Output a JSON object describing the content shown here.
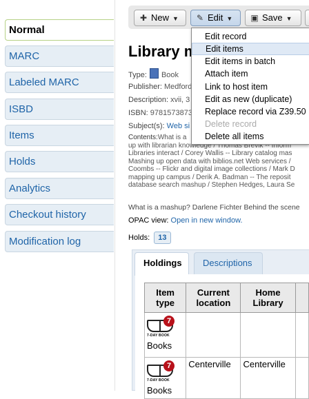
{
  "sidebar": {
    "items": [
      {
        "label": "Normal",
        "active": true
      },
      {
        "label": "MARC"
      },
      {
        "label": "Labeled MARC"
      },
      {
        "label": "ISBD"
      },
      {
        "label": "Items"
      },
      {
        "label": "Holds"
      },
      {
        "label": "Analytics"
      },
      {
        "label": "Checkout history"
      },
      {
        "label": "Modification log"
      }
    ]
  },
  "toolbar": {
    "new_label": "New",
    "edit_label": "Edit",
    "save_label": "Save"
  },
  "edit_menu": {
    "items": [
      {
        "label": "Edit record"
      },
      {
        "label": "Edit items",
        "highlighted": true
      },
      {
        "label": "Edit items in batch"
      },
      {
        "label": "Attach item"
      },
      {
        "label": "Link to host item"
      },
      {
        "label": "Edit as new (duplicate)"
      },
      {
        "label": "Replace record via Z39.50"
      },
      {
        "label": "Delete record",
        "disabled": true
      },
      {
        "label": "Delete all items"
      }
    ]
  },
  "record": {
    "title": "Library m",
    "type_label": "Type:",
    "type_value": "Book",
    "publisher_label": "Publisher:",
    "publisher_value": "Medford",
    "description_label": "Description:",
    "description_value": "xvii, 3",
    "isbn_label": "ISBN:",
    "isbn_value": "9781573873",
    "subjects_label": "Subject(s):",
    "subjects_value": "Web si",
    "contents_label": "Contents:",
    "contents_lines": [
      "What is a",
      "up with librarian knowledge / Thomas Brevik -- Inform",
      "Libraries interact / Corey Wallis -- Library catalog mas",
      "Mashing up open data with biblios.net Web services /",
      "Coombs -- Flickr and digital image collections / Mark D",
      "mapping up campus / Derik A. Badman -- The reposit",
      "database search mashup / Stephen Hedges, Laura Se"
    ],
    "summary": "What is a mashup? Darlene Fichter Behind the scene",
    "opac_label": "OPAC view:",
    "opac_link": "Open in new window.",
    "holds_label": "Holds:",
    "holds_count": "13"
  },
  "tabs": [
    {
      "label": "Holdings",
      "active": true
    },
    {
      "label": "Descriptions"
    }
  ],
  "holdings_table": {
    "headers": [
      "Item type",
      "Current location",
      "Home Library"
    ],
    "rows": [
      {
        "item_type": "Books",
        "icon_badge": "7",
        "icon_caption": "7-DAY BOOK",
        "current_location": "",
        "home_library": ""
      },
      {
        "item_type": "Books",
        "icon_badge": "7",
        "icon_caption": "7-DAY BOOK",
        "current_location": "Centerville",
        "home_library": "Centerville"
      }
    ]
  }
}
